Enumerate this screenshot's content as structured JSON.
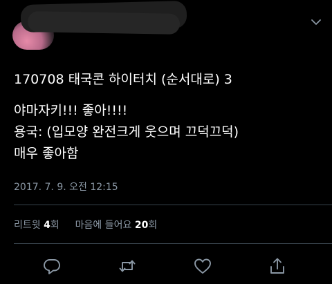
{
  "tweet": {
    "lines": [
      "170708 태국콘 하이터치 (순서대로) 3",
      "야마자키!!! 좋아!!!!",
      "용국: (입모양 완전크게 웃으며 끄덕끄덕)",
      "매우 좋아함"
    ],
    "timestamp": "2017. 7. 9. 오전 12:15",
    "retweets_label": "리트윗",
    "retweets_count": "4",
    "retweets_unit": "회",
    "likes_label": "마음에 들어요",
    "likes_count": "20",
    "likes_unit": "회"
  },
  "icons": {
    "reply": "reply-icon",
    "retweet": "retweet-icon",
    "like": "heart-icon",
    "share": "share-icon",
    "menu": "chevron-down-icon"
  },
  "colors": {
    "background": "#000000",
    "text": "#ffffff",
    "secondary": "#8b98a5",
    "divider": "#38444d"
  }
}
